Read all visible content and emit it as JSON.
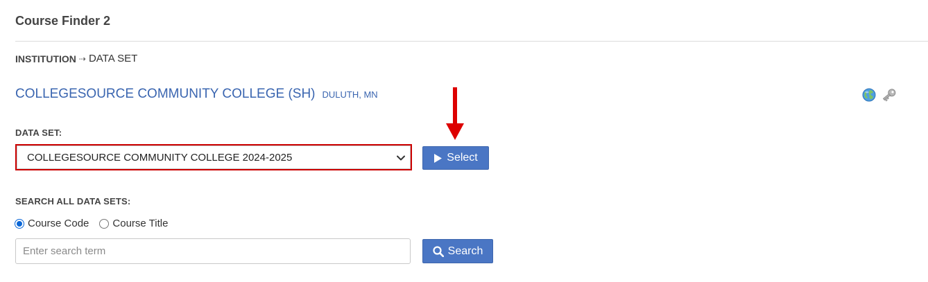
{
  "page": {
    "title": "Course Finder 2"
  },
  "breadcrumb": {
    "institution": "INSTITUTION",
    "separator": "⇢",
    "dataset": "DATA SET"
  },
  "institution": {
    "name": "COLLEGESOURCE COMMUNITY COLLEGE (SH)",
    "location": "DULUTH, MN",
    "icons": [
      "globe-icon",
      "key-icon"
    ]
  },
  "dataset": {
    "label": "DATA SET:",
    "selected": "COLLEGESOURCE COMMUNITY COLLEGE 2024-2025",
    "select_button": "Select"
  },
  "search": {
    "label": "SEARCH ALL DATA SETS:",
    "options": [
      {
        "label": "Course Code",
        "checked": true
      },
      {
        "label": "Course Title",
        "checked": false
      }
    ],
    "placeholder": "Enter search term",
    "value": "",
    "search_button": "Search"
  },
  "colors": {
    "accent": "#4a76c4",
    "link": "#3a65b0",
    "highlight": "#cc0000"
  }
}
